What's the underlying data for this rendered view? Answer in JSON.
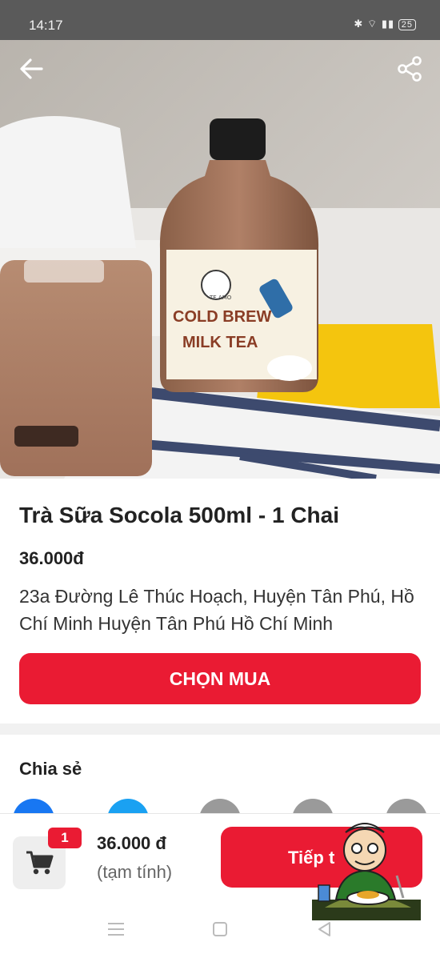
{
  "status_bar": {
    "time": "14:17",
    "icons": [
      "bluetooth-icon",
      "wifi-icon",
      "signal-icon",
      "battery-icon"
    ],
    "battery": "25"
  },
  "header": {
    "back_icon": "back-arrow-icon",
    "share_icon": "share-icon"
  },
  "hero_image": {
    "label_line1": "COLD BREW",
    "label_line2": "MILK TEA",
    "logo_text": "TE AMO"
  },
  "product": {
    "title": "Trà Sữa Socola 500ml - 1 Chai",
    "price": "36.000đ",
    "address": "23a Đường Lê Thúc Hoạch, Huyện Tân Phú, Hồ Chí Minh Huyện Tân Phú Hồ Chí Minh",
    "buy_label": "CHỌN MUA"
  },
  "share": {
    "title": "Chia sẻ",
    "channels": [
      {
        "icon": "facebook-icon",
        "color": "#1877f2"
      },
      {
        "icon": "messenger-icon",
        "color": "#1aa1f2"
      },
      {
        "icon": "share-option-icon",
        "color": "#9a9a9a"
      },
      {
        "icon": "share-option-icon",
        "color": "#9a9a9a"
      },
      {
        "icon": "share-option-icon",
        "color": "#9a9a9a"
      }
    ]
  },
  "cart": {
    "icon": "cart-icon",
    "badge": "1",
    "total": "36.000 đ",
    "note": "(tạm tính)",
    "continue_label": "Tiếp t"
  },
  "nav": {
    "items": [
      "menu-icon",
      "home-icon",
      "back-icon"
    ]
  },
  "colors": {
    "accent": "#ea1b33",
    "status_bar": "#5a5a5a"
  }
}
